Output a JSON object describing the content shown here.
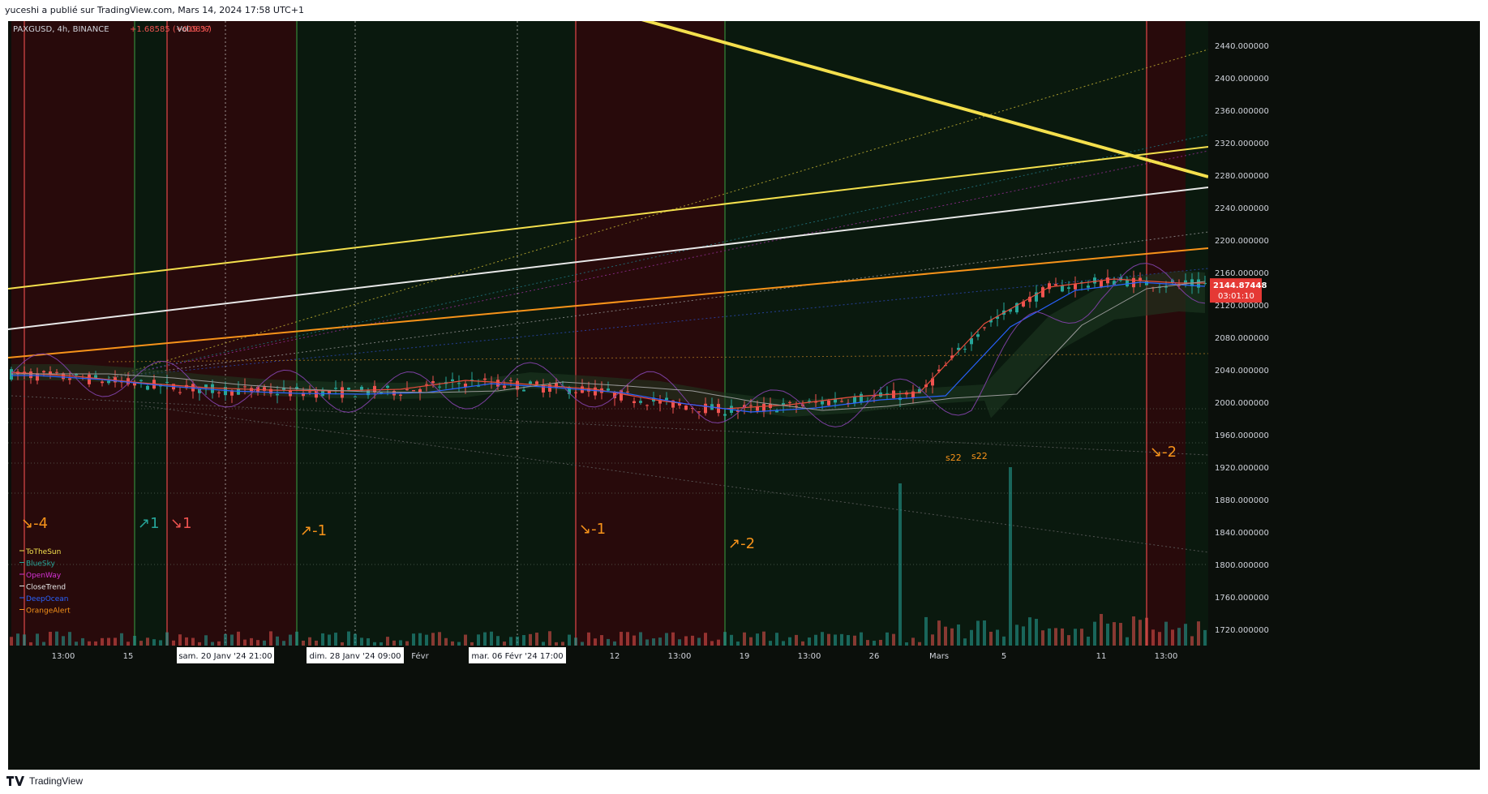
{
  "header": {
    "text": "yuceshi a publié sur TradingView.com, Mars 14, 2024 17:58 UTC+1"
  },
  "footer": {
    "brand": "TradingView"
  },
  "colors": {
    "background": "#0b0f0b",
    "bear_zone": "#2a0b0c",
    "bull_zone": "#0b1a0f",
    "up": "#26a69a",
    "down": "#ef5350",
    "yellow": "#f4e04d",
    "white": "#e8e8e8",
    "orange": "#f7931a",
    "blue": "#2962ff",
    "purple": "#7b3fa0",
    "teal": "#26a69a",
    "magenta": "#d633d6",
    "price_label_bg": "#e53935"
  },
  "chart_data": {
    "type": "line",
    "title": "PAXGUSD, 4h, BINANCE",
    "change_text": "+1.68585 (+0.08%)",
    "volume_label": "Vol",
    "volume_value": "19.37",
    "ylabel": "",
    "xlabel": "",
    "ylim": [
      1700,
      2480
    ],
    "y_ticks": [
      "2440.000000",
      "2400.000000",
      "2360.000000",
      "2320.000000",
      "2280.000000",
      "2240.000000",
      "2200.000000",
      "2160.000000",
      "2120.000000",
      "2080.000000",
      "2040.000000",
      "2000.000000",
      "1960.000000",
      "1920.000000",
      "1880.000000",
      "1840.000000",
      "1800.000000",
      "1760.000000",
      "1720.000000"
    ],
    "x_ticks": [
      "13:00",
      "15",
      "sam. 20 Janv '24   21:00",
      "dim. 28 Janv '24   09:00",
      "Févr",
      "mar. 06 Févr '24   17:00",
      "12",
      "13:00",
      "19",
      "13:00",
      "26",
      "Mars",
      "5",
      "11",
      "13:00"
    ],
    "x_tick_index": [
      8,
      18,
      33,
      53,
      63,
      78,
      93,
      103,
      113,
      123,
      133,
      143,
      153,
      168,
      178
    ],
    "last_price": "2144.87448",
    "countdown": "03:01:10",
    "grid": true,
    "legend_position": "bottom-left",
    "series": [
      {
        "name": "Price",
        "x": [
          "0",
          "10",
          "20",
          "30",
          "40",
          "50",
          "60",
          "70",
          "80",
          "90",
          "100",
          "110",
          "120",
          "130",
          "140",
          "150",
          "160",
          "170",
          "180"
        ],
        "values": [
          2035,
          2030,
          2022,
          2016,
          2013,
          2012,
          2014,
          2025,
          2020,
          2014,
          2000,
          1990,
          1995,
          2005,
          2010,
          2095,
          2140,
          2150,
          2145
        ]
      }
    ],
    "indicator_lines": [
      {
        "name": "ToTheSun",
        "from": 2140,
        "to": 2315,
        "color": "#f4e04d"
      },
      {
        "name": "CloseTrend",
        "from": 2090,
        "to": 2265,
        "color": "#e8e8e8"
      },
      {
        "name": "OrangeAlert",
        "from": 2055,
        "to": 2190,
        "color": "#f7931a"
      }
    ],
    "resistance_line": {
      "from": 2570,
      "to": 2278,
      "color": "#f4e04d"
    },
    "legend": [
      "ToTheSun",
      "BlueSky",
      "OpenWay",
      "CloseTrend",
      "DeepOcean",
      "OrangeAlert"
    ],
    "signals": [
      {
        "label": "↘-4",
        "color": "#f7931a"
      },
      {
        "label": "↗1",
        "color": "#26a69a"
      },
      {
        "label": "↘1",
        "color": "#ef5350"
      },
      {
        "label": "↗-1",
        "color": "#f7931a"
      },
      {
        "label": "↘-1",
        "color": "#f7931a"
      },
      {
        "label": "↗-2",
        "color": "#f7931a"
      },
      {
        "label": "↘-2",
        "color": "#f7931a"
      }
    ],
    "small_labels": [
      "s22",
      "s22"
    ]
  }
}
